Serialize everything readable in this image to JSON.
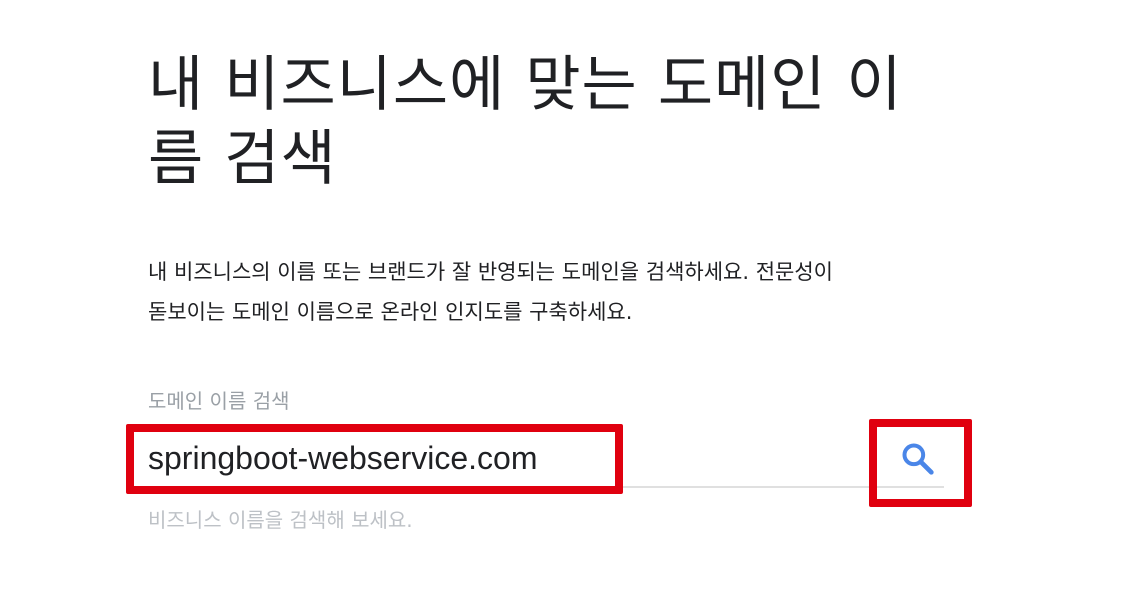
{
  "hero": {
    "title_line1": "내 비즈니스에 맞는 도메인 이",
    "title_line2": "름 검색"
  },
  "description": {
    "line1": "내 비즈니스의 이름 또는 브랜드가 잘 반영되는 도메인을 검색하세요. 전문성이",
    "line2": "돋보이는 도메인 이름으로 온라인 인지도를 구축하세요."
  },
  "search": {
    "label": "도메인 이름 검색",
    "value": "springboot-webservice.com",
    "helper": "비즈니스 이름을 검색해 보세요.",
    "button_icon": "search-icon"
  },
  "colors": {
    "accent_blue": "#4a86e8",
    "highlight_red": "#e0000f"
  }
}
